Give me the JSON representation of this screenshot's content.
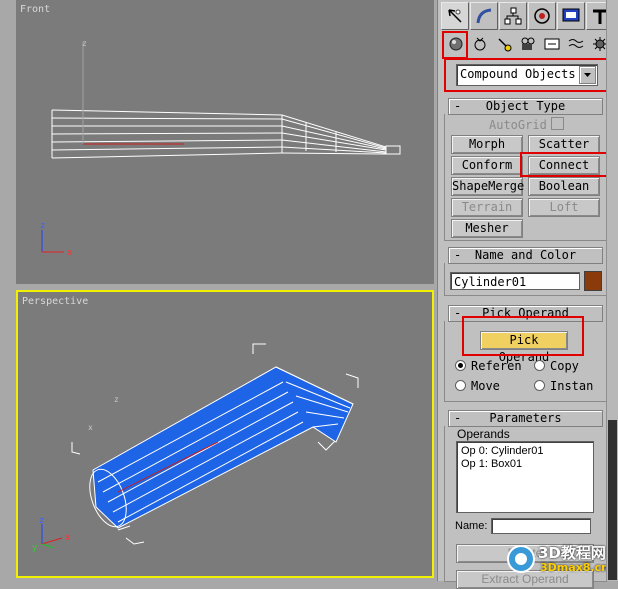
{
  "viewports": {
    "front": {
      "label": "Front"
    },
    "perspective": {
      "label": "Perspective"
    }
  },
  "axis_labels": {
    "x": "x",
    "y": "y",
    "z": "z"
  },
  "command_panel": {
    "tabs": [
      {
        "icon": "create-icon",
        "active": true
      },
      {
        "icon": "modify-icon"
      },
      {
        "icon": "hierarchy-icon"
      },
      {
        "icon": "motion-icon"
      },
      {
        "icon": "display-icon"
      },
      {
        "icon": "utilities-icon"
      }
    ],
    "subtabs": [
      {
        "icon": "geometry-icon",
        "active": true
      },
      {
        "icon": "shapes-icon"
      },
      {
        "icon": "lights-icon"
      },
      {
        "icon": "cameras-icon"
      },
      {
        "icon": "helpers-icon"
      },
      {
        "icon": "space-warps-icon"
      },
      {
        "icon": "systems-icon"
      }
    ],
    "category_dropdown": {
      "value": "Compound Objects"
    },
    "object_type": {
      "title": "Object Type",
      "autogrid": "AutoGrid",
      "buttons": [
        "Morph",
        "Scatter",
        "Conform",
        "Connect",
        "ShapeMerge",
        "Boolean",
        "Terrain",
        "Loft",
        "Mesher"
      ]
    },
    "name_and_color": {
      "title": "Name and Color",
      "name_value": "Cylinder01",
      "color": "#8b3a0c"
    },
    "pick_operand": {
      "title": "Pick Operand",
      "button": "Pick Operand",
      "options": [
        "Referen",
        "Copy",
        "Move",
        "Instan"
      ]
    },
    "parameters": {
      "title": "Parameters",
      "operands_label": "Operands",
      "operands": [
        "Op 0: Cylinder01",
        "Op 1: Box01"
      ],
      "name_label": "Name:",
      "delete_button": "Delete",
      "extract_button": "Extract Operand"
    }
  },
  "watermark": {
    "line1": "3D教程网",
    "line2": "3Dmax8.cn"
  },
  "colors": {
    "highlight": "#e00000",
    "selected_object": "#1e64e6",
    "active_viewport_border": "#f0f000",
    "pick_button": "#f0d060"
  }
}
